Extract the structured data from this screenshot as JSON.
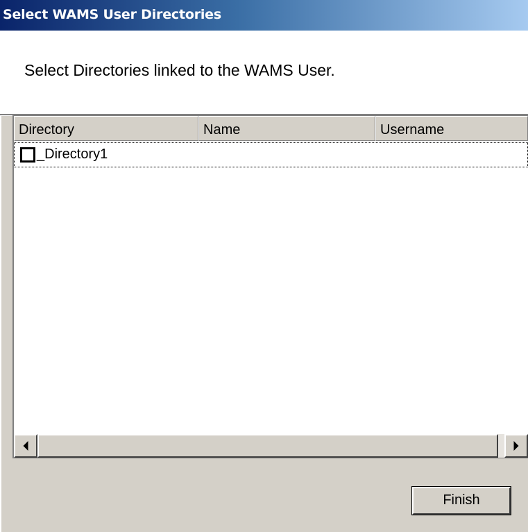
{
  "window": {
    "title": "Select WAMS User Directories"
  },
  "header": {
    "instruction": "Select Directories linked to the WAMS User."
  },
  "list": {
    "columns": [
      "Directory",
      "Name",
      "Username"
    ],
    "rows": [
      {
        "directory": "_Directory1",
        "name": "",
        "username": "",
        "checked": false
      }
    ]
  },
  "footer": {
    "finish_label": "Finish"
  },
  "icons": {
    "scroll_left": "arrow-left-icon",
    "scroll_right": "arrow-right-icon"
  },
  "colors": {
    "title_gradient_start": "#0a246a",
    "title_gradient_end": "#a6caf0",
    "dialog_bg": "#d4d0c8"
  }
}
